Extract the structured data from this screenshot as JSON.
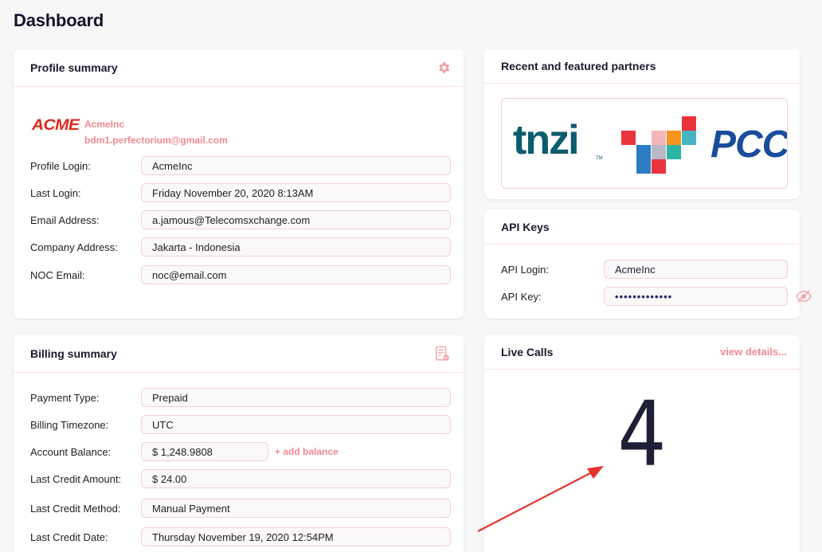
{
  "page": {
    "title": "Dashboard"
  },
  "profile": {
    "title": "Profile summary",
    "logo_text": "ACME",
    "company_name": "AcmeInc",
    "company_email": "bdm1.perfectorium@gmail.com",
    "fields": [
      {
        "label": "Profile Login:",
        "value": "AcmeInc"
      },
      {
        "label": "Last Login:",
        "value": "Friday November 20, 2020 8:13AM"
      },
      {
        "label": "Email Address:",
        "value": "a.jamous@Telecomsxchange.com"
      },
      {
        "label": "Company Address:",
        "value": "Jakarta - Indonesia"
      },
      {
        "label": "NOC Email:",
        "value": "noc@email.com"
      }
    ]
  },
  "billing": {
    "title": "Billing summary",
    "add_balance_label": "+ add balance",
    "fields": [
      {
        "label": "Payment Type:",
        "value": "Prepaid"
      },
      {
        "label": "Billing Timezone:",
        "value": "UTC"
      },
      {
        "label": "Account Balance:",
        "value": "$ 1,248.9808"
      },
      {
        "label": "Last Credit Amount:",
        "value": "$ 24.00"
      },
      {
        "label": "Last Credit Method:",
        "value": "Manual Payment"
      },
      {
        "label": "Last Credit Date:",
        "value": "Thursday November 19, 2020 12:54PM"
      }
    ]
  },
  "partners": {
    "title": "Recent and featured partners",
    "logos": [
      "tnzi",
      "PCC"
    ]
  },
  "api": {
    "title": "API Keys",
    "login_label": "API Login:",
    "login_value": "AcmeInc",
    "key_label": "API Key:",
    "key_value": "•••••••••••••"
  },
  "live_calls": {
    "title": "Live Calls",
    "view_details": "view details...",
    "count": "4"
  },
  "colors": {
    "accent": "#f08a90",
    "field_border": "#f4d0d3",
    "title": "#14142b",
    "arrow": "#e0362c"
  }
}
